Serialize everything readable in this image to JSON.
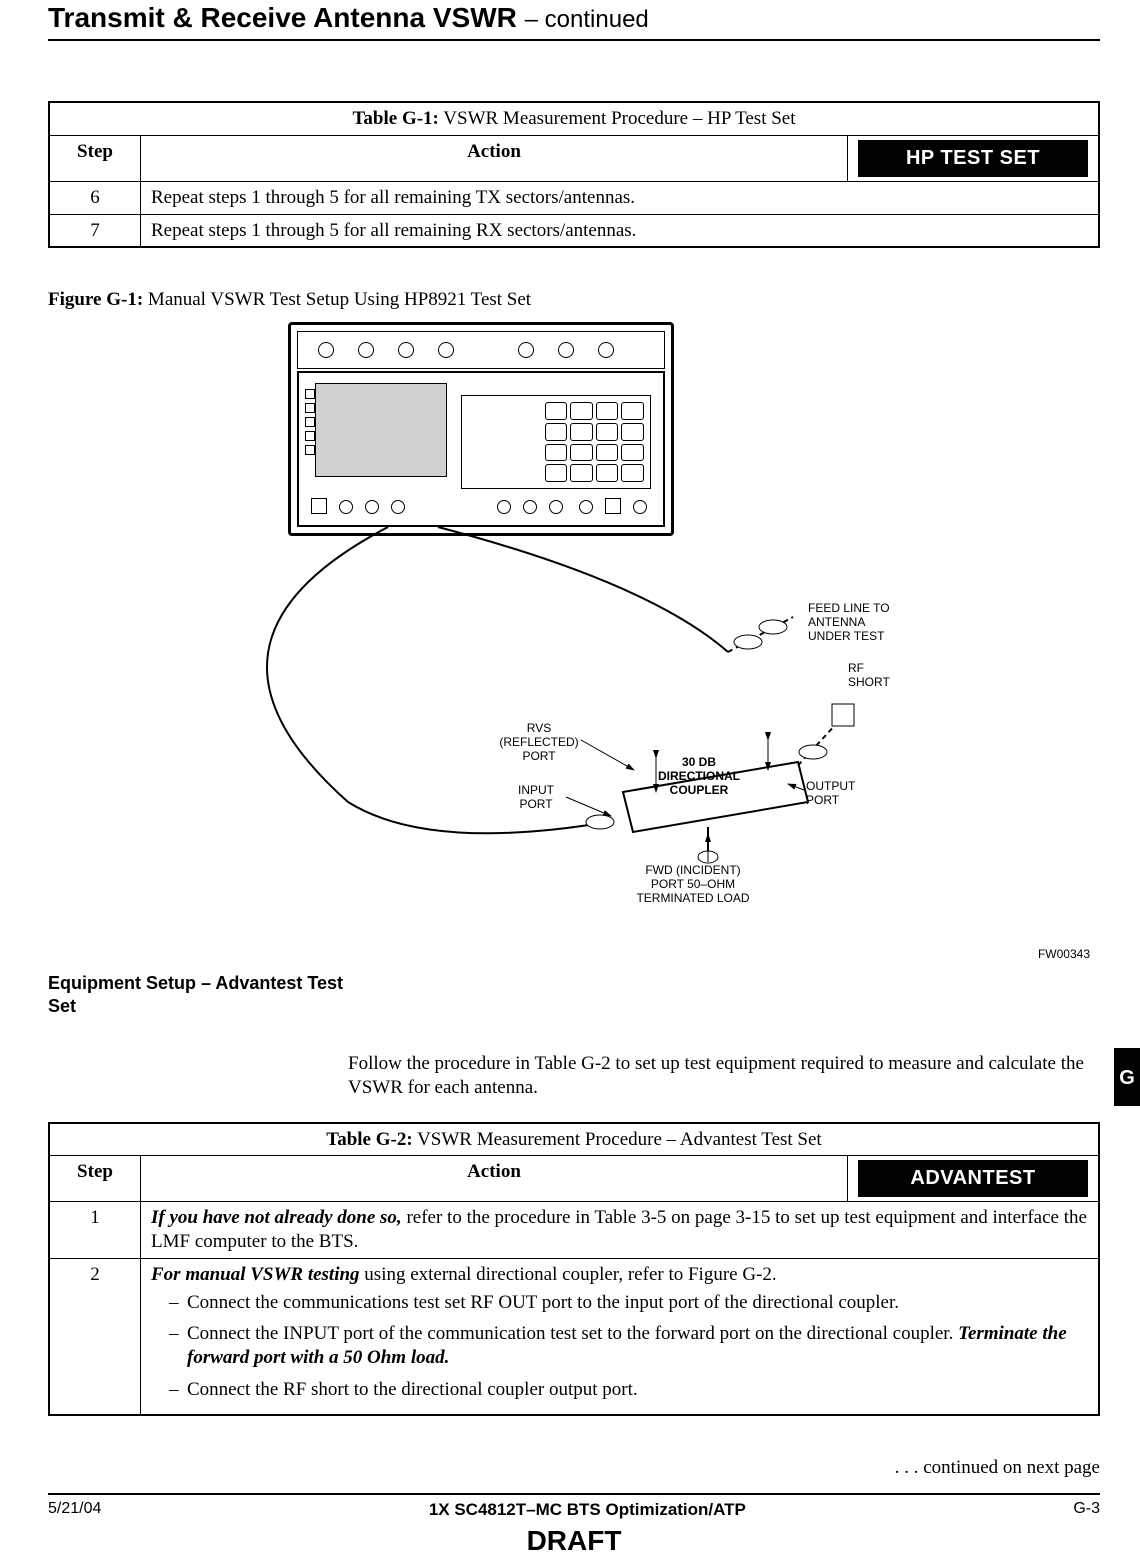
{
  "header": {
    "title": "Transmit & Receive Antenna VSWR",
    "continued": " – continued"
  },
  "table_g1": {
    "title_prefix": "Table G-1:",
    "title_rest": " VSWR Measurement Procedure – HP Test Set",
    "col_step": "Step",
    "col_action": "Action",
    "badge": "HP TEST SET",
    "rows": [
      {
        "step": "6",
        "action": "Repeat steps 1 through 5 for all remaining TX sectors/antennas."
      },
      {
        "step": "7",
        "action": "Repeat steps 1 through 5 for all remaining RX sectors/antennas."
      }
    ]
  },
  "figure_g1": {
    "caption_prefix": "Figure G-1:",
    "caption_rest": " Manual VSWR Test Setup Using HP8921 Test Set",
    "labels": {
      "feed": "FEED LINE TO\nANTENNA\nUNDER TEST",
      "rfshort": "RF\nSHORT",
      "rvs": "RVS\n(REFLECTED)\nPORT",
      "input": "INPUT\nPORT",
      "output": "OUTPUT\nPORT",
      "coupler": "30 DB\nDIRECTIONAL\nCOUPLER",
      "fwd": "FWD (INCIDENT)\nPORT 50–OHM\nTERMINATED LOAD"
    },
    "ref": "FW00343"
  },
  "chapter_tab": "G",
  "section": {
    "heading": "Equipment Setup – Advantest Test Set",
    "body": "Follow the procedure in Table G-2 to set up test equipment required to measure and calculate the VSWR for each antenna."
  },
  "table_g2": {
    "title_prefix": "Table G-2:",
    "title_rest": " VSWR Measurement Procedure – Advantest Test Set",
    "col_step": "Step",
    "col_action": "Action",
    "badge": "ADVANTEST",
    "rows": {
      "r1": {
        "step": "1",
        "lead_em": "If you have not already done so,",
        "lead_rest": " refer to the procedure in Table 3-5 on page 3-15 to set up test equipment and interface the LMF computer to the BTS."
      },
      "r2": {
        "step": "2",
        "lead_em": "For manual VSWR testing",
        "lead_rest": " using external directional coupler, refer to Figure G-2.",
        "bullets": [
          {
            "pre": "Connect the communications test set RF OUT port to the input port of the directional coupler."
          },
          {
            "pre": "Connect the INPUT port of the communication test set to the forward port on the directional coupler. ",
            "em": "Terminate the forward port with a 50 Ohm load."
          },
          {
            "pre": "Connect the RF short to the directional coupler output port."
          }
        ]
      }
    }
  },
  "continued_next": ". . . continued on next page",
  "footer": {
    "date": "5/21/04",
    "center": "1X SC4812T–MC BTS Optimization/ATP",
    "page": "G-3",
    "draft": "DRAFT"
  }
}
